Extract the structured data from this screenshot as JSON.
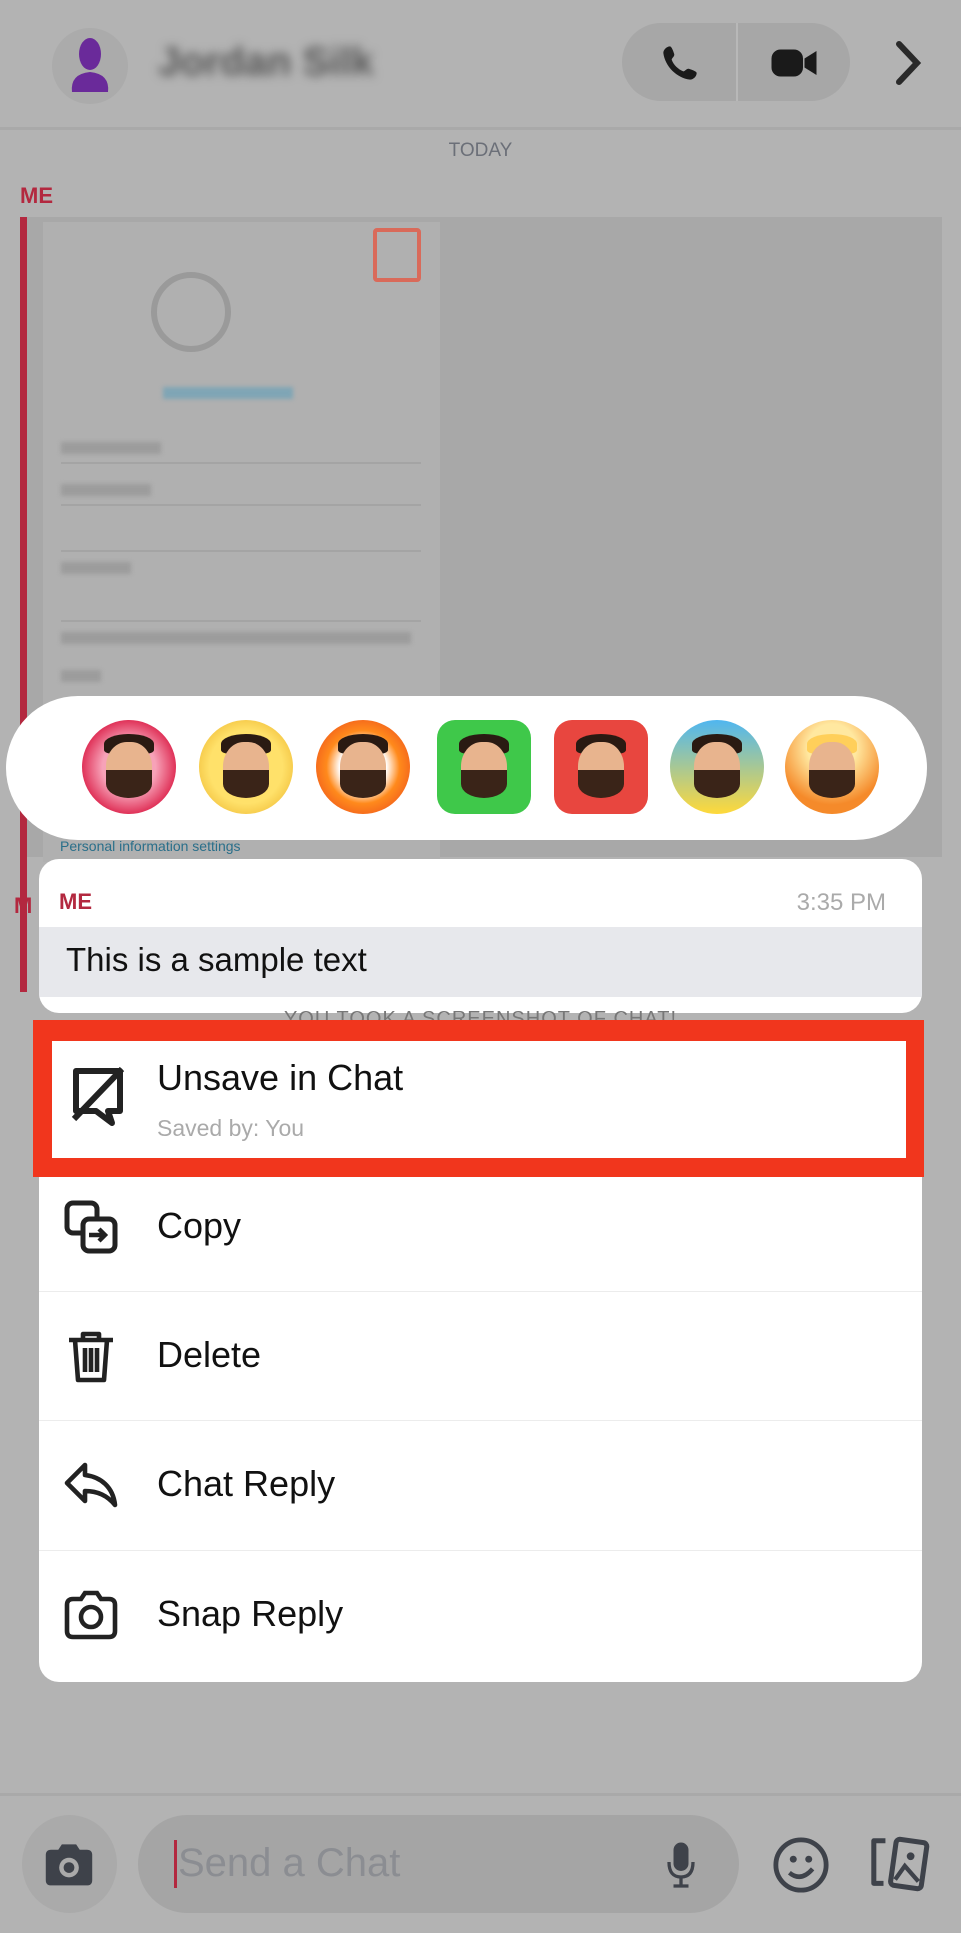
{
  "header": {
    "contact_name": "Jordan Silk",
    "icons": [
      "avatar-icon",
      "phone-icon",
      "video-icon",
      "chevron-right-icon"
    ]
  },
  "chat": {
    "date_label": "TODAY",
    "sender_label": "ME",
    "partial_sender_label": "M",
    "screenshot_caption": "Personal information settings",
    "screenshot_notice": "YOU TOOK A SCREENSHOT OF CHAT!"
  },
  "reactions": [
    "heart",
    "laughing",
    "fire",
    "thumbs-up",
    "thumbs-down",
    "crying",
    "mind-blown"
  ],
  "message": {
    "sender": "ME",
    "time": "3:35 PM",
    "text": "This is a sample text"
  },
  "menu": {
    "unsave": {
      "label": "Unsave in Chat",
      "saved_by": "Saved by:  You"
    },
    "items": [
      {
        "label": "Copy",
        "icon": "copy-icon"
      },
      {
        "label": "Delete",
        "icon": "trash-icon"
      },
      {
        "label": "Chat Reply",
        "icon": "reply-icon"
      },
      {
        "label": "Snap Reply",
        "icon": "camera-icon"
      }
    ]
  },
  "composer": {
    "placeholder": "Send a Chat"
  },
  "colors": {
    "accent_red": "#b3283f",
    "highlight": "#f1361d",
    "avatar": "#6a2a9a"
  }
}
